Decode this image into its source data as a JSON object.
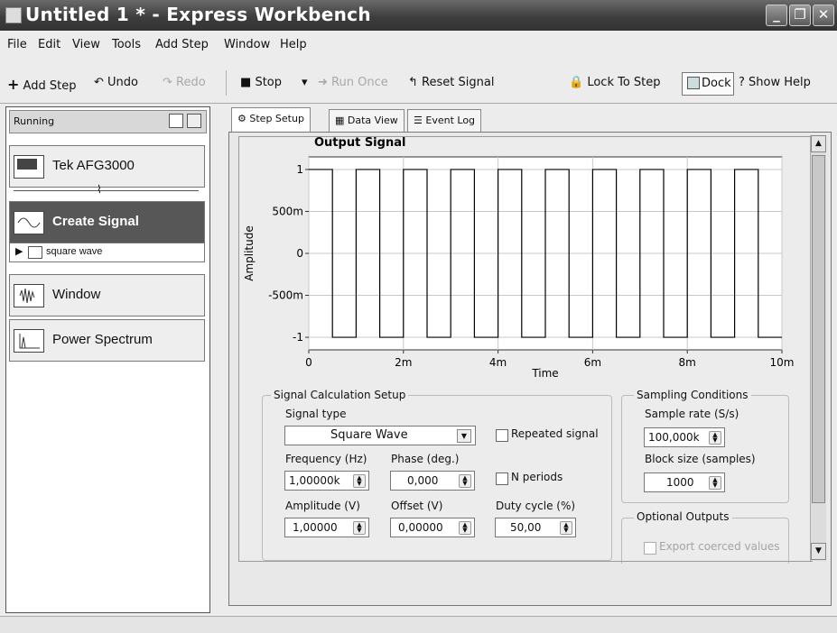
{
  "window": {
    "title": "Untitled 1 * - Express Workbench"
  },
  "menu": [
    "File",
    "Edit",
    "View",
    "Tools",
    "Add Step",
    "Window",
    "Help"
  ],
  "toolbar": {
    "add_step": "Add Step",
    "undo": "Undo",
    "redo": "Redo",
    "stop": "Stop",
    "run_once": "Run Once",
    "reset_signal": "Reset Signal",
    "lock_to_step": "Lock To Step",
    "dock": "Dock",
    "show_help": "Show Help"
  },
  "left_panel": {
    "status": "Running",
    "steps": [
      {
        "label": "Tek AFG3000",
        "icon": "instrument-icon"
      },
      {
        "label": "Create Signal",
        "icon": "signal-icon",
        "selected": true,
        "sub_item": "square wave"
      },
      {
        "label": "Window",
        "icon": "window-icon"
      },
      {
        "label": "Power Spectrum",
        "icon": "spectrum-icon"
      }
    ]
  },
  "tabs": [
    {
      "label": "Step Setup",
      "active": true
    },
    {
      "label": "Data View"
    },
    {
      "label": "Event Log"
    }
  ],
  "chart_data": {
    "type": "line",
    "title": "Output Signal",
    "xlabel": "Time",
    "ylabel": "Amplitude",
    "xlim": [
      0,
      0.01
    ],
    "ylim": [
      -1.15,
      1.15
    ],
    "x_ticks": [
      "0",
      "2m",
      "4m",
      "6m",
      "8m",
      "10m"
    ],
    "y_ticks": [
      "1",
      "500m",
      "0",
      "-500m",
      "-1"
    ],
    "y_tick_values": [
      1,
      0.5,
      0,
      -0.5,
      -1
    ],
    "grid": true,
    "series": [
      {
        "frequency_hz": 1000,
        "amplitude": 1,
        "duty_cycle_pct": 50,
        "offset": 0,
        "phase_deg": 0
      }
    ]
  },
  "setup": {
    "calc_group": "Signal Calculation Setup",
    "signal_type_label": "Signal type",
    "signal_type_value": "Square Wave",
    "repeated_signal": "Repeated signal",
    "frequency_label": "Frequency (Hz)",
    "frequency_value": "1,00000k",
    "phase_label": "Phase (deg.)",
    "phase_value": "0,000",
    "n_periods": "N periods",
    "amplitude_label": "Amplitude (V)",
    "amplitude_value": "1,00000",
    "offset_label": "Offset (V)",
    "offset_value": "0,00000",
    "duty_label": "Duty cycle (%)",
    "duty_value": "50,00",
    "sampling_group": "Sampling Conditions",
    "sample_rate_label": "Sample rate (S/s)",
    "sample_rate_value": "100,000k",
    "block_size_label": "Block size (samples)",
    "block_size_value": "1000",
    "optional_group": "Optional Outputs",
    "export_coerced": "Export coerced values"
  }
}
